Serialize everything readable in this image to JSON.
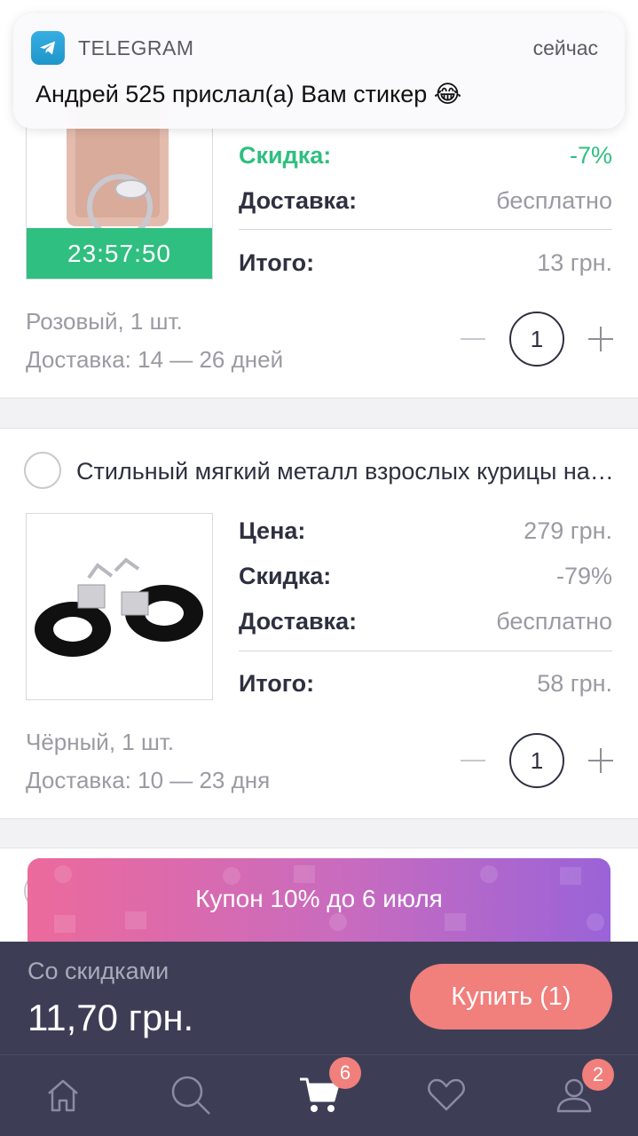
{
  "notification": {
    "app": "TELEGRAM",
    "time": "сейчас",
    "message": "Андрей 525 прислал(а) Вам стикер 😂"
  },
  "items": [
    {
      "timer": "23:57:50",
      "discount_label": "Скидка:",
      "discount_value": "-7%",
      "delivery_label": "Доставка:",
      "delivery_value": "бесплатно",
      "total_label": "Итого:",
      "total_value": "13 грн.",
      "variant": "Розовый, 1 шт.",
      "shipping": "Доставка: 14 — 26 дней",
      "quantity": "1"
    },
    {
      "title": "Стильный мягкий металл взрослых курицы наручники",
      "price_label": "Цена:",
      "price_value": "279 грн.",
      "discount_label": "Скидка:",
      "discount_value": "-79%",
      "delivery_label": "Доставка:",
      "delivery_value": "бесплатно",
      "total_label": "Итого:",
      "total_value": "58 грн.",
      "variant": "Чёрный, 1 шт.",
      "shipping": "Доставка: 10 — 23 дня",
      "quantity": "1"
    }
  ],
  "coupon": {
    "text": "Купон 10% до 6 июля"
  },
  "checkout": {
    "label": "Со скидками",
    "total": "11,70 грн.",
    "buy_button": "Купить (1)"
  },
  "tabbar": {
    "tabs": [
      {
        "icon": "home-icon"
      },
      {
        "icon": "search-icon"
      },
      {
        "icon": "cart-icon",
        "badge": "6"
      },
      {
        "icon": "heart-icon"
      },
      {
        "icon": "profile-icon",
        "badge": "2"
      }
    ]
  },
  "colors": {
    "accent_green": "#2fbf80",
    "buy_button": "#f17f7c",
    "bottom_bar": "#3d3e55"
  }
}
